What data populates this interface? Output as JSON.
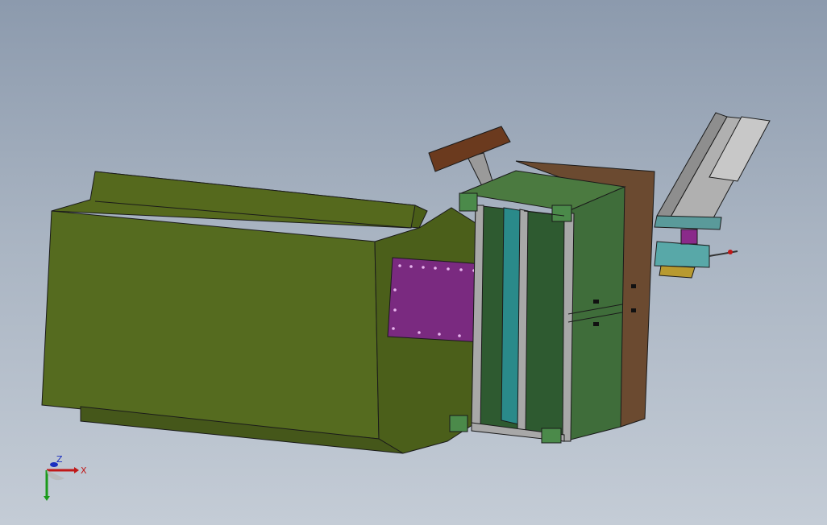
{
  "viewport": {
    "background_top": "#8c9aad",
    "background_bottom": "#c4ccd6"
  },
  "model": {
    "parts": [
      {
        "name": "green-machine-housing",
        "color": "#556b1f"
      },
      {
        "name": "magenta-side-panel",
        "color": "#7a2a80"
      },
      {
        "name": "frame-cabinet",
        "color": "#3f6d3a"
      },
      {
        "name": "brown-side-panel",
        "color": "#6b4a30"
      },
      {
        "name": "control-arm-box",
        "color": "#6b3a1e"
      },
      {
        "name": "linear-rail-arm",
        "color": "#8e8e8e"
      }
    ]
  },
  "triad": {
    "x_label": "X",
    "y_label": "Y",
    "z_label": "Z",
    "x_color": "#c01818",
    "y_color": "#1a9a1a",
    "z_color": "#1a2ec0"
  }
}
